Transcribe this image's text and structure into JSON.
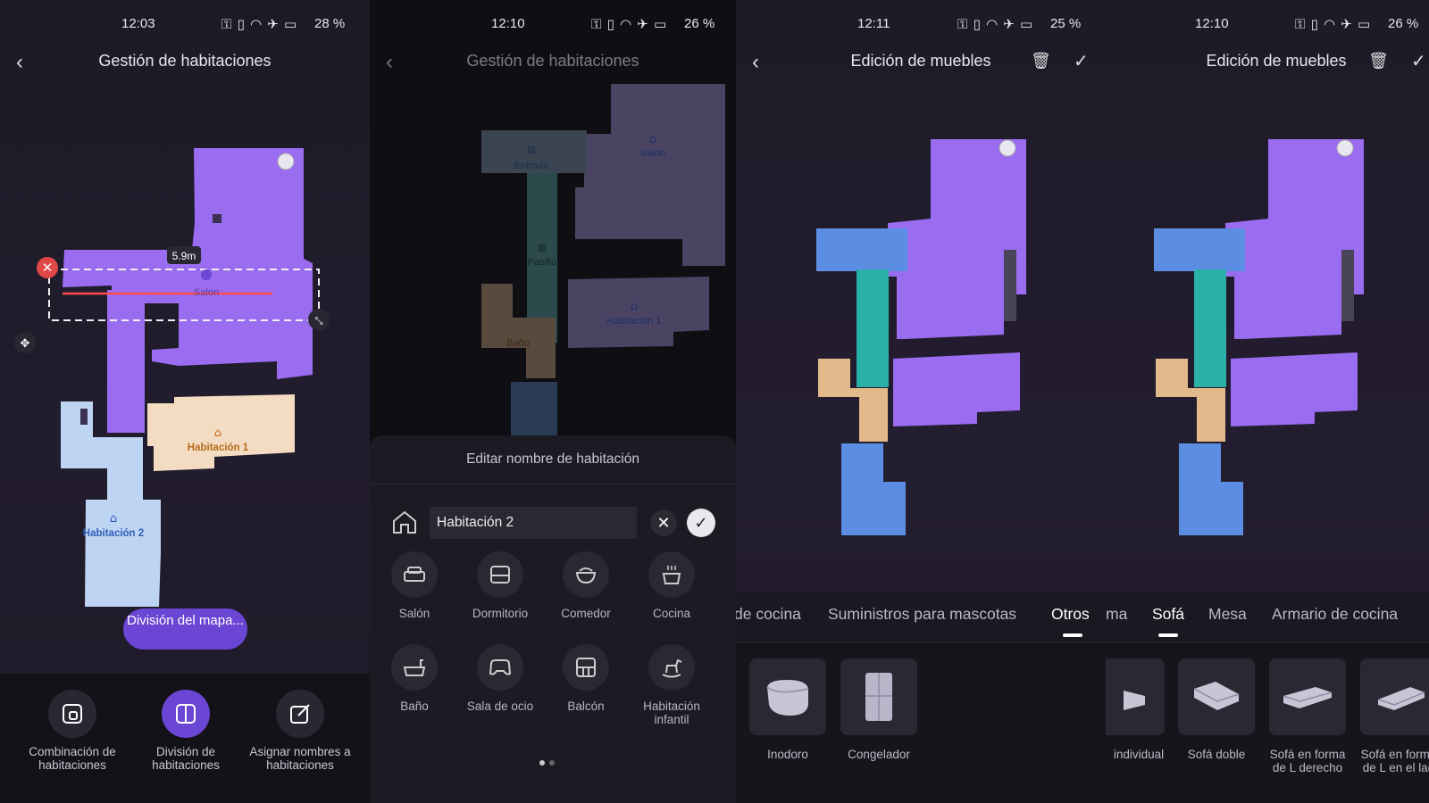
{
  "panel1": {
    "status": {
      "time": "12:03",
      "battery": "28 %"
    },
    "title": "Gestión de habitaciones",
    "measure": "5.9m",
    "rooms": [
      "Salon",
      "Habitación 1",
      "Habitación 2"
    ],
    "pill": "División del mapa...",
    "tools": [
      {
        "label": "Combinación de habitaciones",
        "icon": "merge-icon"
      },
      {
        "label": "División de habitaciones",
        "icon": "split-icon"
      },
      {
        "label": "Asignar nombres a habitaciones",
        "icon": "rename-icon"
      }
    ]
  },
  "panel2": {
    "status": {
      "time": "12:10",
      "battery": "26 %"
    },
    "title": "Gestión de habitaciones",
    "rooms": [
      "Entrada",
      "Salón",
      "Pasillo",
      "Habitación 1",
      "Baño"
    ],
    "sheet_title": "Editar nombre de habitación",
    "name_value": "Habitación 2",
    "room_types": [
      {
        "label": "Salón",
        "icon": "sofa-icon"
      },
      {
        "label": "Dormitorio",
        "icon": "bed-icon"
      },
      {
        "label": "Comedor",
        "icon": "bowl-icon"
      },
      {
        "label": "Cocina",
        "icon": "pot-icon"
      },
      {
        "label": "Baño",
        "icon": "bathtub-icon"
      },
      {
        "label": "Sala de ocio",
        "icon": "gamepad-icon"
      },
      {
        "label": "Balcón",
        "icon": "balcony-icon"
      },
      {
        "label": "Habitación infantil",
        "icon": "rocking-horse-icon"
      }
    ]
  },
  "panel3": {
    "status": {
      "time": "12:11",
      "battery": "25 %"
    },
    "title": "Edición de muebles",
    "categories": [
      "de cocina",
      "Suministros para mascotas",
      "Otros"
    ],
    "active_category": "Otros",
    "furniture": [
      {
        "label": "Inodoro",
        "icon": "toilet-icon"
      },
      {
        "label": "Congelador",
        "icon": "fridge-icon"
      }
    ]
  },
  "panel4": {
    "status": {
      "time": "12:10",
      "battery": "26 %"
    },
    "title": "Edición de muebles",
    "categories": [
      "ma",
      "Sofá",
      "Mesa",
      "Armario de cocina"
    ],
    "active_category": "Sofá",
    "furniture": [
      {
        "label": "individual",
        "icon": "single-sofa-icon"
      },
      {
        "label": "Sofá doble",
        "icon": "double-sofa-icon"
      },
      {
        "label": "Sofá en forma de L derecho",
        "icon": "l-sofa-right-icon"
      },
      {
        "label": "Sofá en forma de L en el lad",
        "icon": "l-sofa-left-icon"
      }
    ]
  },
  "colors": {
    "accent": "#6b45d4",
    "room_purple": "#9a6cf0",
    "room_blue": "#5b8ee3",
    "room_teal": "#2bb0a8",
    "room_tan": "#e2b98a",
    "room_light_blue": "#bed4f3",
    "room_cream": "#f4dcc2"
  }
}
